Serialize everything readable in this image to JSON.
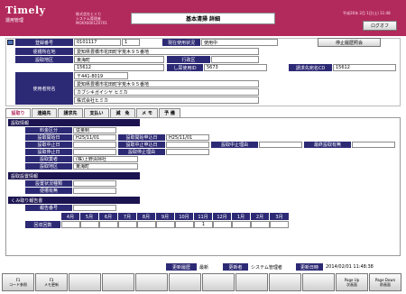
{
  "header": {
    "logo": "Timely",
    "logo_sub": "運用管理",
    "company_line1": "株式会社ヒミカ",
    "company_line2": "システム管理者",
    "company_line3": "MOXX0001Z0701",
    "screen_title": "基本清掃 詳細",
    "date_text": "平成26年 2月 1日(土)",
    "time_text": "11:48",
    "logoff_label": "ログオフ"
  },
  "record": {
    "reg_no_label": "登録番号",
    "reg_no": "0101117",
    "reg_no_sub": "1",
    "status_label": "現在使用状況",
    "status_value": "使用中",
    "stop_history_button": "停止履歴照会",
    "location_label": "便槽所在地",
    "location_value": "愛知県豊橋市花田町字荒木９５番地",
    "area_label": "設取地区",
    "area_value": "東海町",
    "admin_area_label": "行政区",
    "admin_area_value": "",
    "code_value": "15612",
    "meter_label": "し尿使用ID",
    "meter_value": "5673",
    "billing_label": "請求先宛名CD",
    "billing_value": "15612",
    "owner_label": "使用者宛名",
    "postal": "〒441-8019",
    "owner_address": "愛知県豊橋市花田町字荒木９５番地",
    "owner_kana": "カブシキガイシヤ ヒミカ",
    "owner_name": "株式会社ヒミカ"
  },
  "tabs": [
    {
      "label": "設取り"
    },
    {
      "label": "連絡先"
    },
    {
      "label": "請求先"
    },
    {
      "label": "支払い"
    },
    {
      "label": "減　免"
    },
    {
      "label": "メ モ"
    },
    {
      "label": "予 備"
    }
  ],
  "collection": {
    "section_title": "設取情報",
    "fee_label": "料金区分",
    "fee_value": "従量制",
    "start_date_label": "設取開始日",
    "start_date_value": "H25/11/01",
    "start_apply_label": "設取開始申込日",
    "start_apply_value": "H25/11/01",
    "midstop_label": "設取中止日",
    "midstop_value": "",
    "midstop_apply_label": "設取中止申込日",
    "midstop_apply_value": "",
    "midstop_reason_label": "設取中止理由",
    "midstop_reason_value": "",
    "last_collect_label": "最終設取有無",
    "last_collect_value": "",
    "pause_label": "設取停止日",
    "pause_value": "",
    "pause_reason_label": "設取停止理由",
    "pause_reason_value": "",
    "vendor_label": "設取業者",
    "vendor_value": "(株)上野清掃社",
    "district_label": "設取地区",
    "district_value": "東海町"
  },
  "facility": {
    "section_title": "設取設置情報",
    "type_label": "設置状況種類",
    "type_value": "",
    "tank_label": "便槽有無",
    "tank_value": ""
  },
  "monthly": {
    "section_title": "くみ取り報告書",
    "remarks_label": "報告番号",
    "remarks_value": "",
    "months": [
      "4月",
      "5月",
      "6月",
      "7月",
      "8月",
      "9月",
      "10月",
      "11月",
      "12月",
      "1月",
      "2月",
      "3月"
    ],
    "count_label": "回収回数",
    "counts": [
      "",
      "",
      "",
      "",
      "",
      "",
      "",
      "1",
      "",
      "",
      "",
      ""
    ]
  },
  "footer_info": {
    "history_label": "更新履歴",
    "history_value": "最新",
    "updater_label": "更新者",
    "updater_value": "システム管理者",
    "updated_label": "更新日時",
    "updated_value": "2014/02/01 11:48:38"
  },
  "fkeys": [
    {
      "key": "F1",
      "label": "コード参照"
    },
    {
      "key": "F3",
      "label": "メモ更新"
    },
    {
      "key": "",
      "label": ""
    },
    {
      "key": "",
      "label": ""
    },
    {
      "key": "",
      "label": ""
    },
    {
      "key": "",
      "label": ""
    },
    {
      "key": "",
      "label": ""
    },
    {
      "key": "",
      "label": ""
    },
    {
      "key": "",
      "label": ""
    },
    {
      "key": "",
      "label": ""
    },
    {
      "key": "Page Up",
      "label": "次画面"
    },
    {
      "key": "Page Down",
      "label": "前画面"
    }
  ],
  "colors": {
    "accent": "#b22a5c",
    "label_bg": "#2d2a75",
    "section_bg": "#1c1450"
  }
}
